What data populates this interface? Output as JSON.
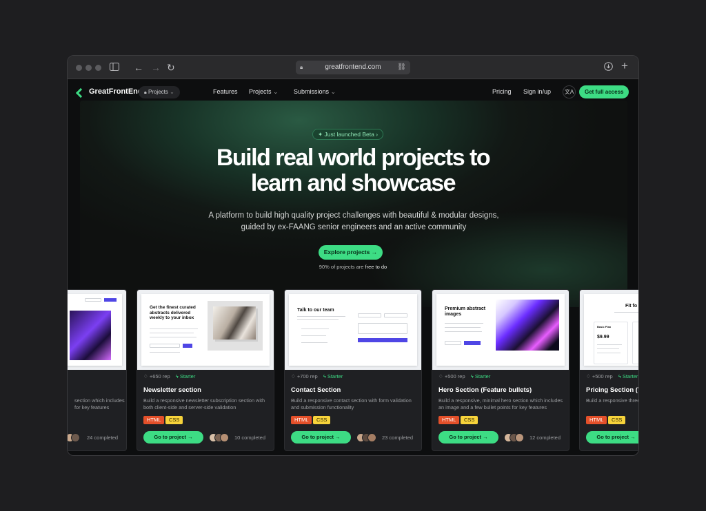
{
  "browser": {
    "url": "greatfrontend.com"
  },
  "nav": {
    "brand": "GreatFrontEnd",
    "projects_pill": "Projects",
    "links": [
      "Features",
      "Projects",
      "Submissions"
    ],
    "pricing": "Pricing",
    "sign_in": "Sign in/up",
    "translate": "文A",
    "cta": "Get full access"
  },
  "hero": {
    "badge": "Just launched Beta",
    "title_line1": "Build real world projects to",
    "title_line2": "learn and showcase",
    "subtitle": "A platform to build high quality project challenges with beautiful & modular designs, guided by ex-FAANG senior engineers and an active community",
    "button": "Explore projects",
    "note_prefix": "90% of projects are ",
    "note_bold": "free to do"
  },
  "colors": {
    "accent": "#3ddc84",
    "html_tag": "#e4502a",
    "css_tag": "#f7d33b"
  },
  "cards": [
    {
      "rep": "",
      "level": "",
      "title": "",
      "desc": "section which includes for key features",
      "tags": [],
      "button": "",
      "completed": "24 completed",
      "thumb_title": ""
    },
    {
      "rep": "+650 rep",
      "level": "Starter",
      "title": "Newsletter section",
      "desc": "Build a responsive newsletter subscription section with both client-side and server-side validation",
      "tags": [
        "HTML",
        "CSS"
      ],
      "button": "Go to project →",
      "completed": "10 completed",
      "thumb_title": "Get the finest curated abstracts delivered weekly to your inbox"
    },
    {
      "rep": "+700 rep",
      "level": "Starter",
      "title": "Contact Section",
      "desc": "Build a responsive contact section with form validation and submission functionality",
      "tags": [
        "HTML",
        "CSS"
      ],
      "button": "Go to project →",
      "completed": "23 completed",
      "thumb_title": "Talk to our team"
    },
    {
      "rep": "+500 rep",
      "level": "Starter",
      "title": "Hero Section (Feature bullets)",
      "desc": "Build a responsive, minimal hero section which includes an image and a few bullet points for key features",
      "tags": [
        "HTML",
        "CSS"
      ],
      "button": "Go to project →",
      "completed": "12 completed",
      "thumb_title": "Premium abstract images"
    },
    {
      "rep": "+500 rep",
      "level": "Starter",
      "title": "Pricing Section (Ti",
      "desc": "Build a responsive three for monthly / annual pric",
      "tags": [
        "HTML",
        "CSS"
      ],
      "button": "Go to project →",
      "completed": "",
      "thumb_title": "Fit fo",
      "thumb_price": "$9.99",
      "thumb_plan": "Basic Plan"
    }
  ]
}
